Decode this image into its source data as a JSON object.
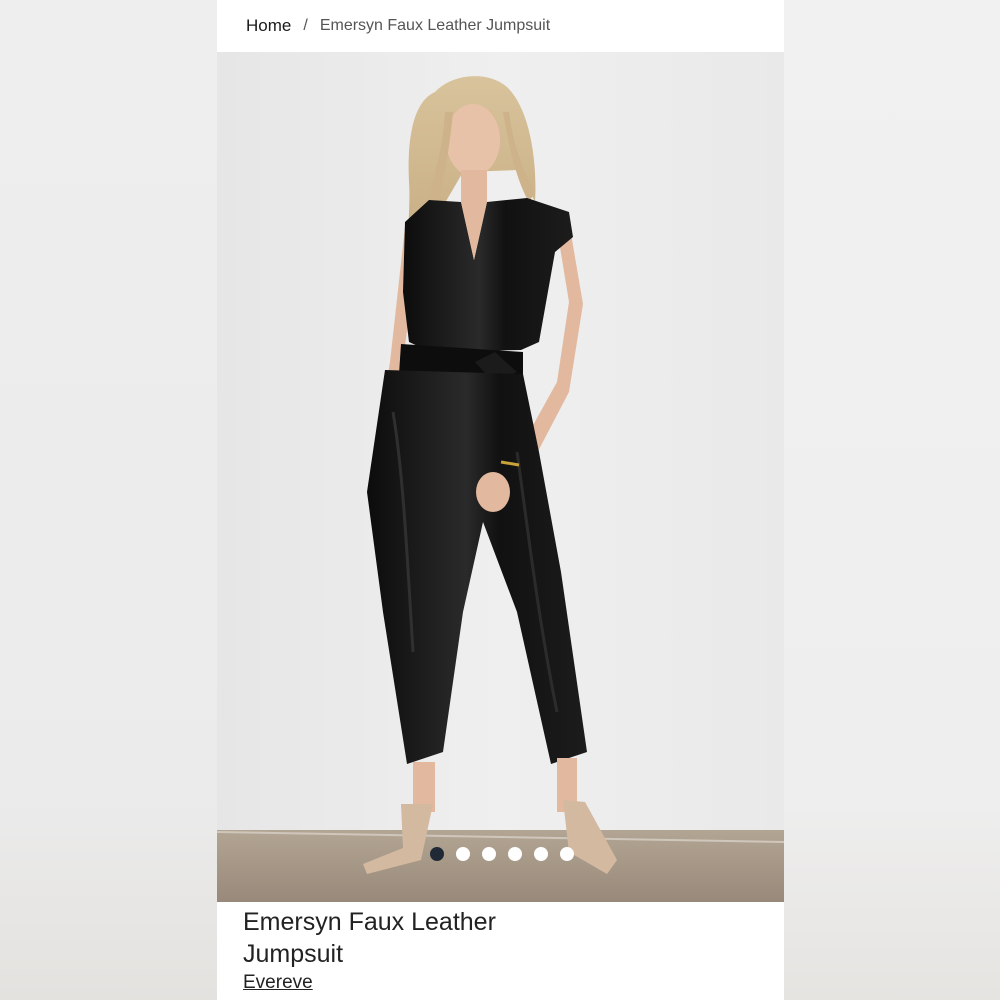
{
  "breadcrumb": {
    "home": "Home",
    "separator": "/",
    "current": "Emersyn Faux Leather Jumpsuit"
  },
  "gallery": {
    "total_images": 6,
    "active_index": 1
  },
  "product": {
    "title": "Emersyn Faux Leather Jumpsuit",
    "brand": "Evereve"
  },
  "colors": {
    "page_background": "#fafafa",
    "text_primary": "#222222",
    "dot_active": "#1f2a36",
    "dot_inactive": "#ffffff",
    "photo_wall": "#ececec",
    "photo_floor": "#a69785",
    "garment": "#121212"
  }
}
